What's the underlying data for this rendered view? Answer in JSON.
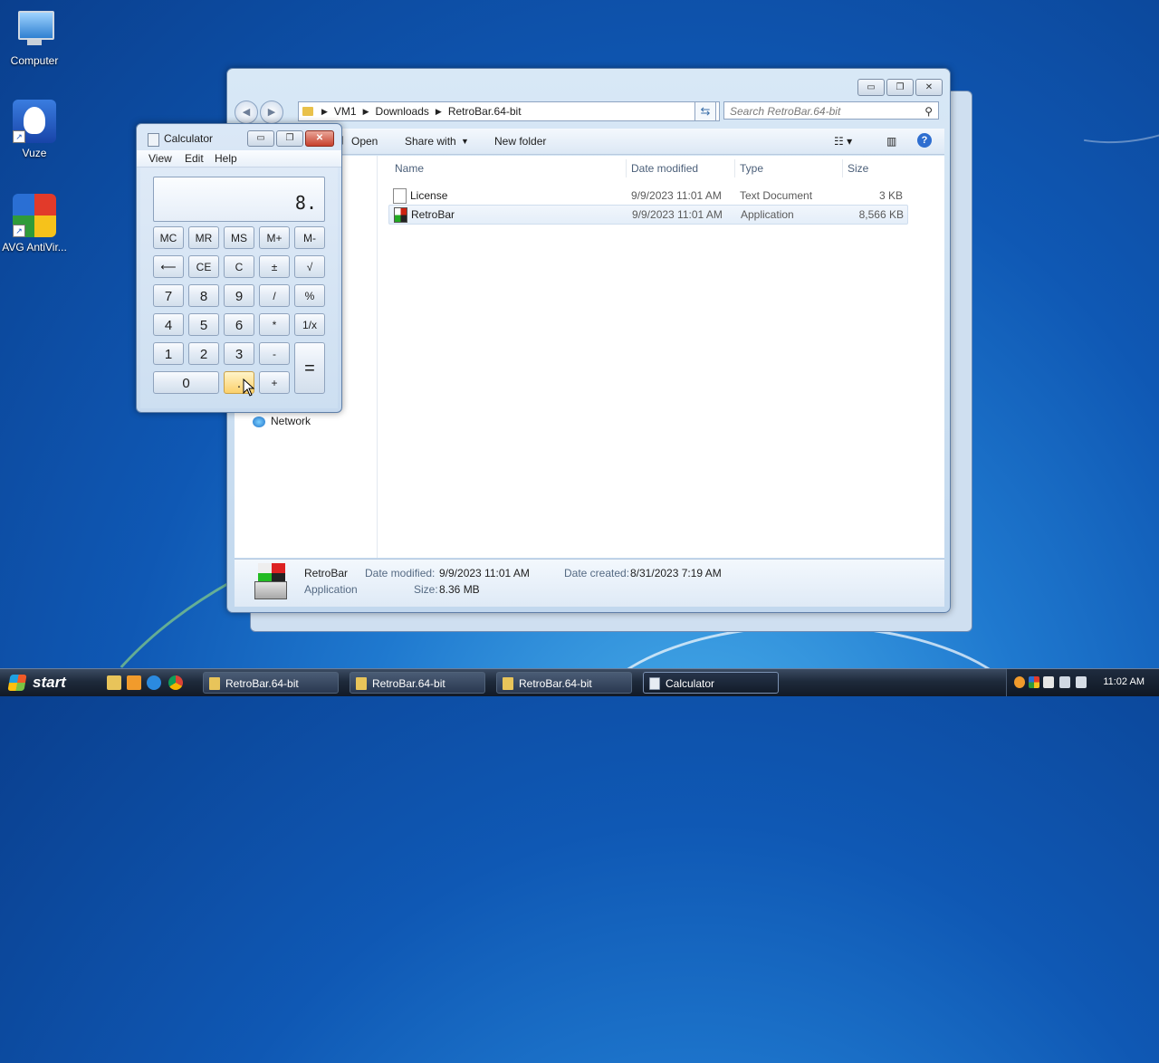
{
  "desktop": {
    "icons": [
      {
        "label": "Computer"
      },
      {
        "label": "Vuze"
      },
      {
        "label": "AVG AntiVir..."
      }
    ]
  },
  "explorer": {
    "buttons": {
      "minimize": "▭",
      "maximize": "❐",
      "close": "✕"
    },
    "breadcrumbs": [
      "VM1",
      "Downloads",
      "RetroBar.64-bit"
    ],
    "search_placeholder": "Search RetroBar.64-bit",
    "toolbar": {
      "open": "Open",
      "share_with": "Share with",
      "new_folder": "New folder"
    },
    "nav_pane": {
      "network": "Network"
    },
    "columns": {
      "name": "Name",
      "date_modified": "Date modified",
      "type": "Type",
      "size": "Size"
    },
    "files": [
      {
        "name": "License",
        "date": "9/9/2023 11:01 AM",
        "type": "Text Document",
        "size": "3 KB"
      },
      {
        "name": "RetroBar",
        "date": "9/9/2023 11:01 AM",
        "type": "Application",
        "size": "8,566 KB"
      }
    ],
    "details": {
      "name": "RetroBar",
      "kind": "Application",
      "date_modified_label": "Date modified:",
      "date_modified": "9/9/2023 11:01 AM",
      "date_created_label": "Date created:",
      "date_created": "8/31/2023 7:19 AM",
      "size_label": "Size:",
      "size": "8.36 MB"
    }
  },
  "calculator": {
    "title": "Calculator",
    "menu": {
      "view": "View",
      "edit": "Edit",
      "help": "Help"
    },
    "display": "8.",
    "keys": {
      "mc": "MC",
      "mr": "MR",
      "ms": "MS",
      "mplus": "M+",
      "mminus": "M-",
      "back": "⟵",
      "ce": "CE",
      "c": "C",
      "pm": "±",
      "sqrt": "√",
      "k7": "7",
      "k8": "8",
      "k9": "9",
      "div": "/",
      "pct": "%",
      "k4": "4",
      "k5": "5",
      "k6": "6",
      "mul": "*",
      "recip": "1/x",
      "k1": "1",
      "k2": "2",
      "k3": "3",
      "sub": "-",
      "eq": "=",
      "k0": "0",
      "dot": ".",
      "add": "+"
    }
  },
  "taskbar": {
    "start": "start",
    "tasks": [
      {
        "label": "RetroBar.64-bit"
      },
      {
        "label": "RetroBar.64-bit"
      },
      {
        "label": "RetroBar.64-bit"
      },
      {
        "label": "Calculator"
      }
    ],
    "clock": "11:02 AM"
  }
}
